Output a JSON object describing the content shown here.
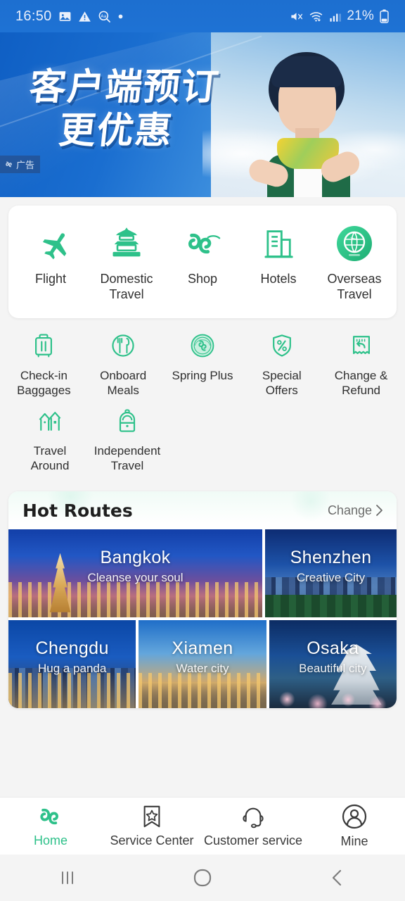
{
  "status_bar": {
    "time": "16:50",
    "battery": "21%",
    "icons": [
      "gallery-icon",
      "warning-icon",
      "text-search-icon",
      "dot-icon",
      "mute-icon",
      "wifi-icon",
      "signal-icon",
      "battery-icon"
    ]
  },
  "banner": {
    "headline_line1": "客户端预订",
    "headline_line2": "更优惠",
    "ad_label": "广告"
  },
  "primary_services": [
    {
      "label": "Flight",
      "icon": "airplane-icon"
    },
    {
      "label": "Domestic\nTravel",
      "icon": "pagoda-icon"
    },
    {
      "label": "Shop",
      "icon": "spring-logo-icon"
    },
    {
      "label": "Hotels",
      "icon": "building-icon"
    },
    {
      "label": "Overseas\nTravel",
      "icon": "globe-icon"
    }
  ],
  "secondary_services": [
    {
      "label": "Check-in\nBaggages",
      "icon": "suitcase-icon"
    },
    {
      "label": "Onboard\nMeals",
      "icon": "cutlery-icon"
    },
    {
      "label": "Spring Plus",
      "icon": "emblem-icon"
    },
    {
      "label": "Special\nOffers",
      "icon": "percent-shield-icon"
    },
    {
      "label": "Change &\nRefund",
      "icon": "receipt-refund-icon"
    },
    {
      "label": "Travel\nAround",
      "icon": "houses-icon"
    },
    {
      "label": "Independent\nTravel",
      "icon": "backpack-icon"
    }
  ],
  "hot_routes": {
    "title": "Hot Routes",
    "change_label": "Change",
    "chevron": "›",
    "cards": [
      {
        "name": "Bangkok",
        "tagline": "Cleanse your soul"
      },
      {
        "name": "Shenzhen",
        "tagline": "Creative City"
      },
      {
        "name": "Chengdu",
        "tagline": "Hug a panda"
      },
      {
        "name": "Xiamen",
        "tagline": "Water city"
      },
      {
        "name": "Osaka",
        "tagline": "Beautiful city"
      }
    ]
  },
  "tab_bar": {
    "items": [
      {
        "label": "Home",
        "icon": "spring-logo-icon",
        "active": true
      },
      {
        "label": "Service Center",
        "icon": "bookmark-star-icon",
        "active": false
      },
      {
        "label": "Customer service",
        "icon": "headset-icon",
        "active": false
      },
      {
        "label": "Mine",
        "icon": "user-circle-icon",
        "active": false
      }
    ]
  },
  "system_nav": {
    "recents": "recents-icon",
    "home": "home-circle-icon",
    "back": "back-chevron-icon"
  },
  "colors": {
    "accent_green": "#2EC18A",
    "banner_blue": "#1D6FD0",
    "page_background": "#F4F4F4"
  }
}
